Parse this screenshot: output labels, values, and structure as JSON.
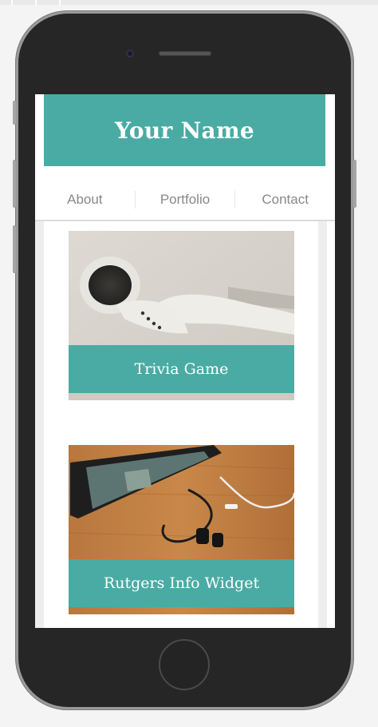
{
  "header": {
    "title": "Your Name"
  },
  "nav": {
    "items": [
      {
        "label": "About"
      },
      {
        "label": "Portfolio"
      },
      {
        "label": "Contact"
      }
    ]
  },
  "projects": [
    {
      "title": "Trivia Game",
      "image": "earbuds-photo"
    },
    {
      "title": "Rutgers Info Widget",
      "image": "phone-earphones-photo"
    }
  ],
  "colors": {
    "accent": "#4aaba4",
    "nav_text": "#888888",
    "device_body": "#262626"
  }
}
